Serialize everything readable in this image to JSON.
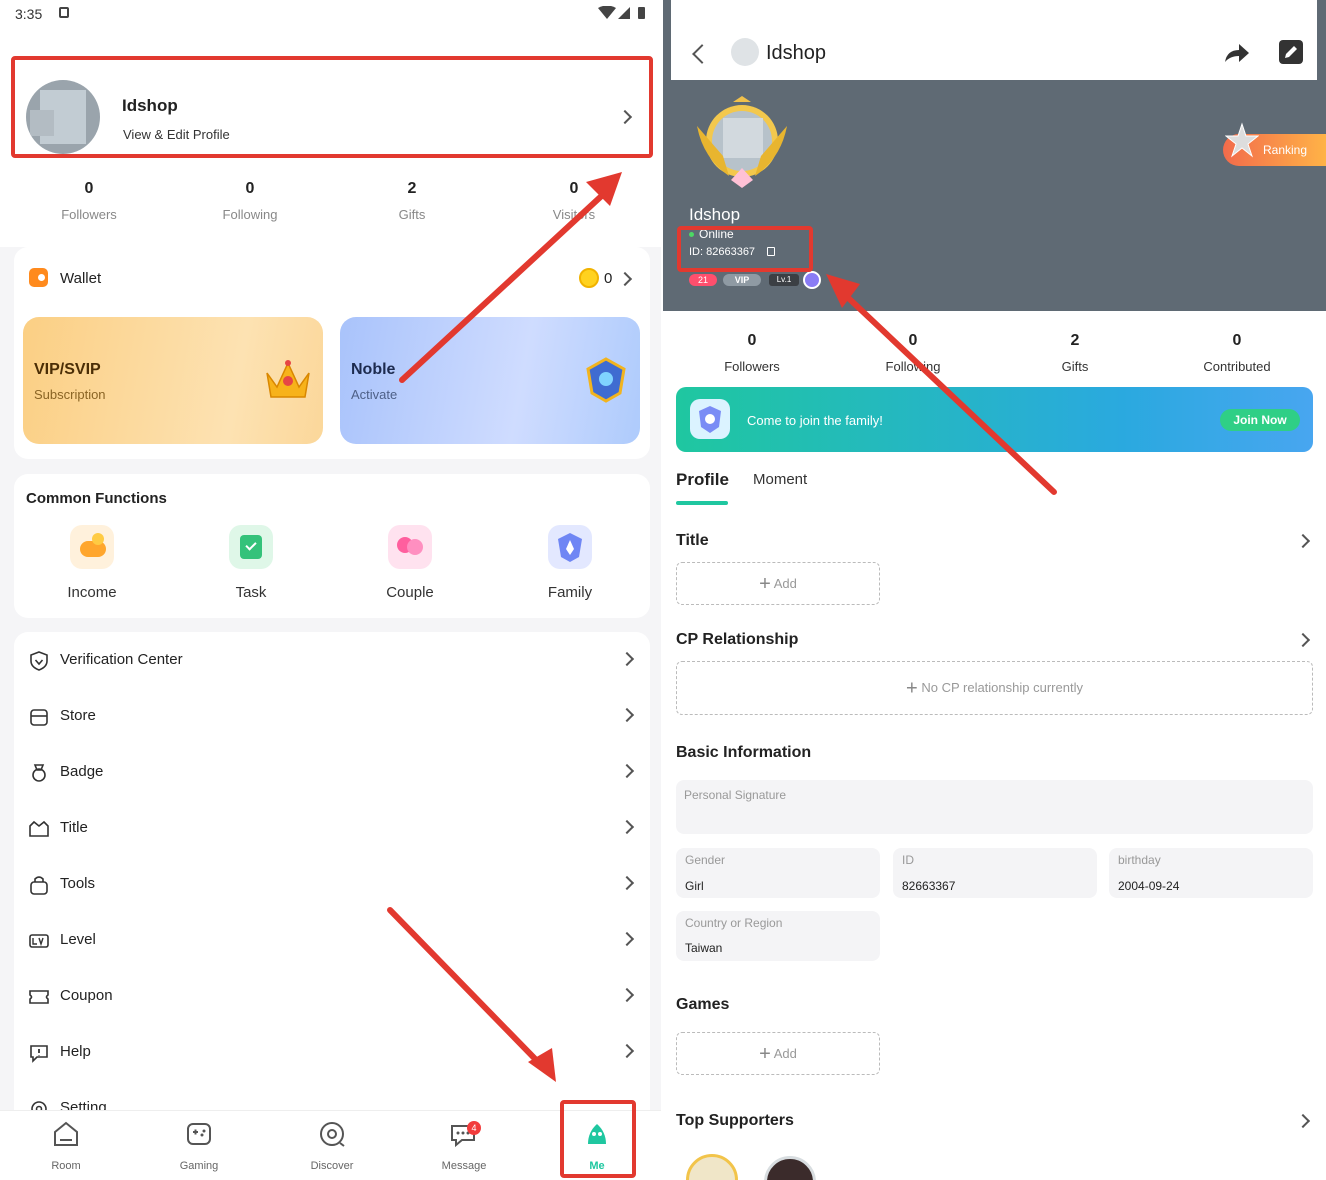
{
  "status_bar": {
    "time": "3:35"
  },
  "left": {
    "profile": {
      "name": "Idshop",
      "sub": "View & Edit Profile"
    },
    "stats": [
      {
        "value": "0",
        "label": "Followers"
      },
      {
        "value": "0",
        "label": "Following"
      },
      {
        "value": "2",
        "label": "Gifts"
      },
      {
        "value": "0",
        "label": "Visitors"
      }
    ],
    "wallet": {
      "label": "Wallet",
      "balance": "0"
    },
    "vip": {
      "title": "VIP/SVIP",
      "sub": "Subscription"
    },
    "noble": {
      "title": "Noble",
      "sub": "Activate"
    },
    "common": {
      "title": "Common Functions",
      "items": [
        "Income",
        "Task",
        "Couple",
        "Family"
      ]
    },
    "menu": [
      "Verification Center",
      "Store",
      "Badge",
      "Title",
      "Tools",
      "Level",
      "Coupon",
      "Help",
      "Setting"
    ],
    "nav": [
      {
        "label": "Room",
        "icon": "home-icon"
      },
      {
        "label": "Gaming",
        "icon": "gamepad-icon"
      },
      {
        "label": "Discover",
        "icon": "discover-icon"
      },
      {
        "label": "Message",
        "icon": "message-icon",
        "badge": "4"
      },
      {
        "label": "Me",
        "icon": "me-icon"
      }
    ]
  },
  "right": {
    "header": {
      "title": "Idshop"
    },
    "ranking": "Ranking",
    "name": "Idshop",
    "status": "Online",
    "id_text": "ID: 82663367",
    "badges": {
      "level_num": "21",
      "vip": "VIP",
      "lv": "Lv.1"
    },
    "stats": [
      {
        "value": "0",
        "label": "Followers"
      },
      {
        "value": "0",
        "label": "Following"
      },
      {
        "value": "2",
        "label": "Gifts"
      },
      {
        "value": "0",
        "label": "Contributed"
      }
    ],
    "family_banner": {
      "text": "Come to join the family!",
      "button": "Join Now"
    },
    "tabs": [
      "Profile",
      "Moment"
    ],
    "title_section": {
      "title": "Title",
      "add": "Add"
    },
    "cp": {
      "title": "CP Relationship",
      "empty": "No CP relationship currently"
    },
    "basic": {
      "title": "Basic Information",
      "signature_placeholder": "Personal Signature",
      "gender": {
        "label": "Gender",
        "value": "Girl"
      },
      "id": {
        "label": "ID",
        "value": "82663367"
      },
      "birthday": {
        "label": "birthday",
        "value": "2004-09-24"
      },
      "region": {
        "label": "Country or Region",
        "value": "Taiwan"
      }
    },
    "games": {
      "title": "Games",
      "add": "Add"
    },
    "supporters": {
      "title": "Top Supporters"
    }
  },
  "colors": {
    "accent_green": "#1fc7a0",
    "highlight_red": "#e2392f",
    "header_gray": "#5f6a74"
  }
}
